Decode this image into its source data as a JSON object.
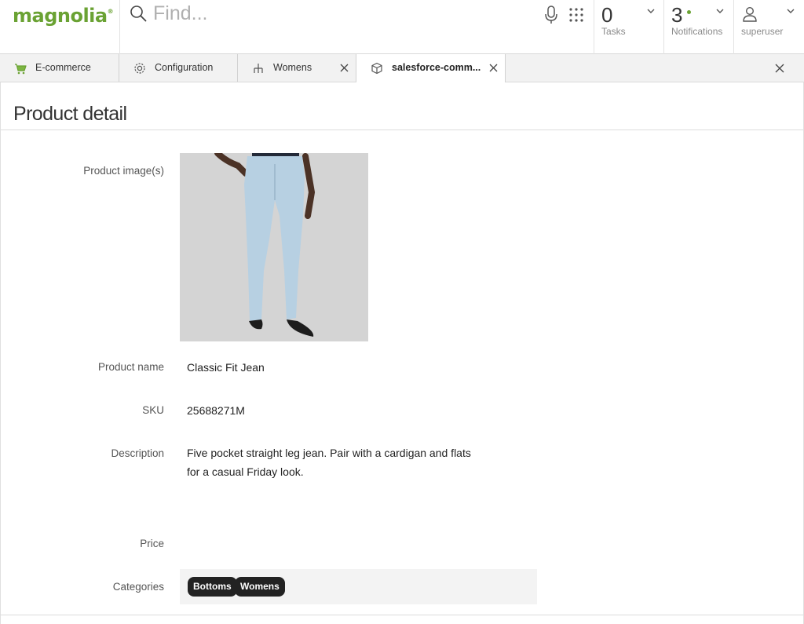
{
  "header": {
    "logo_text": "magnolia",
    "logo_mark": "®",
    "search_placeholder": "Find...",
    "tasks": {
      "count": "0",
      "label": "Tasks"
    },
    "notifications": {
      "count": "3",
      "label": "Notifications"
    },
    "user": {
      "label": "superuser"
    }
  },
  "tabs": [
    {
      "label": "E-commerce",
      "icon": "cart-icon",
      "closable": false
    },
    {
      "label": "Configuration",
      "icon": "gear-icon",
      "closable": false
    },
    {
      "label": "Womens",
      "icon": "hierarchy-icon",
      "closable": true
    },
    {
      "label": "salesforce-comm...",
      "icon": "cube-icon",
      "closable": true,
      "active": true
    }
  ],
  "page": {
    "title": "Product detail",
    "fields": {
      "images_label": "Product image(s)",
      "name_label": "Product name",
      "name_value": "Classic Fit Jean",
      "sku_label": "SKU",
      "sku_value": "25688271M",
      "description_label": "Description",
      "description_value": "Five pocket straight leg jean. Pair with a cardigan and flats for a casual Friday look.",
      "price_label": "Price",
      "price_value": "",
      "categories_label": "Categories",
      "categories": [
        "Bottoms",
        "Womens"
      ]
    }
  },
  "colors": {
    "brand": "#6aa233",
    "chip_bg": "#222222",
    "categories_bg": "#f3f3f3"
  }
}
